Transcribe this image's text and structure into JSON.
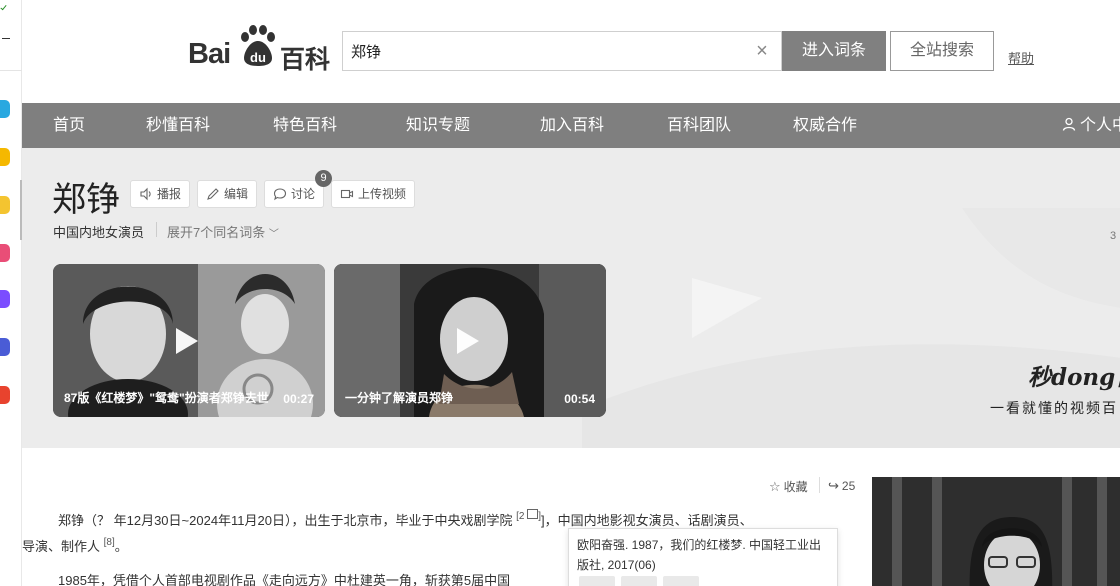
{
  "header": {
    "logo_left": "Bai",
    "logo_du": "du",
    "logo_right": "百科",
    "search_value": "郑铮",
    "enter_button": "进入词条",
    "site_search_button": "全站搜索",
    "help_link": "帮助"
  },
  "nav": {
    "items": [
      {
        "label": "首页"
      },
      {
        "label": "秒懂百科"
      },
      {
        "label": "特色百科"
      },
      {
        "label": "知识专题"
      },
      {
        "label": "加入百科"
      },
      {
        "label": "百科团队"
      },
      {
        "label": "权威合作"
      }
    ],
    "user_label": "个人中"
  },
  "entry": {
    "title": "郑铮",
    "tools": {
      "play": "播报",
      "edit": "编辑",
      "discuss": "讨论",
      "discuss_count": "9",
      "upload": "上传视频"
    },
    "description": "中国内地女演员",
    "expand": "展开7个同名词条"
  },
  "videos": [
    {
      "caption": "87版《红楼梦》\"鸳鸯\"扮演者郑铮去世",
      "duration": "00:27"
    },
    {
      "caption": "一分钟了解演员郑铮",
      "duration": "00:54"
    }
  ],
  "banner": {
    "brand": "秒dong百",
    "slogan": "一看就懂的视频百",
    "side_count": "3"
  },
  "content": {
    "favorite": "收藏",
    "share_count": "25",
    "para1_a": "郑铮（？ 年12月30日~2024年11月20日），出生于北京市，毕业于中央戏剧学院",
    "para1_ref1": "[2",
    "para1_b": "]，中国内地影视女演员、话剧演员、",
    "para1_c": "导演、制作人",
    "para1_ref2": "[8]",
    "para1_d": "。",
    "para2": "1985年，凭借个人首部电视剧作品《走向远方》中杜建英一角，斩获第5届中国",
    "tooltip": "欧阳奋强. 1987，我们的红楼梦. 中国轻工业出版社, 2017(06)"
  },
  "colors": {
    "nav_bg": "#7f7f7f",
    "title_bg": "#ececec",
    "enter_btn_bg": "#808080",
    "badge_bg": "#666666"
  }
}
